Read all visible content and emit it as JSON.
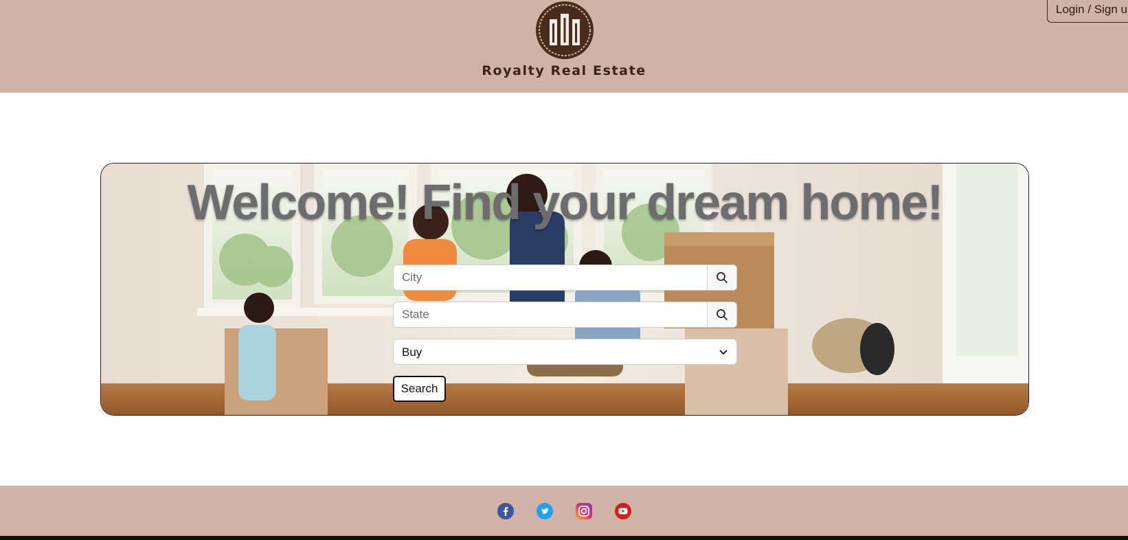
{
  "header": {
    "brand": "Royalty Real Estate",
    "login_label": "Login / Sign up",
    "logo_icon": "building-crest-icon",
    "background_color": "#cfb3a6"
  },
  "hero": {
    "title": "Welcome! Find your dream home!",
    "city": {
      "placeholder": "City",
      "value": ""
    },
    "state": {
      "placeholder": "State",
      "value": ""
    },
    "listing_type": {
      "selected": "Buy"
    },
    "search_label": "Search",
    "search_icon": "search-icon"
  },
  "footer": {
    "social": [
      {
        "name": "facebook-icon",
        "color": "#3b5998"
      },
      {
        "name": "twitter-icon",
        "color": "#1da1f2"
      },
      {
        "name": "instagram-icon",
        "color": "#e1306c"
      },
      {
        "name": "youtube-icon",
        "color": "#cd201f"
      }
    ]
  }
}
